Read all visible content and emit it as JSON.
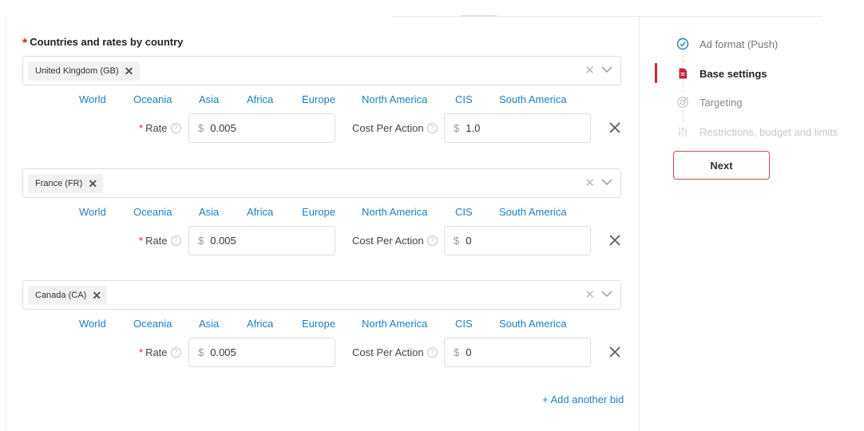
{
  "section": {
    "title": "Countries and rates by country",
    "required_mark": "*"
  },
  "regions": [
    "World",
    "Oceania",
    "Asia",
    "Africa",
    "Europe",
    "North America",
    "CIS",
    "South America"
  ],
  "labels": {
    "rate": "Rate",
    "rate_required": "*",
    "cpa": "Cost Per Action",
    "help_glyph": "?",
    "currency": "$",
    "tag_remove": "✕",
    "clear": "✕"
  },
  "bids": [
    {
      "country": "United Kingdom (GB)",
      "rate": "0.005",
      "cpa": "1.0"
    },
    {
      "country": "France (FR)",
      "rate": "0.005",
      "cpa": "0"
    },
    {
      "country": "Canada (CA)",
      "rate": "0.005",
      "cpa": "0"
    }
  ],
  "add_bid_label": "+ Add another bid",
  "steps": [
    {
      "label": "Ad format (Push)",
      "state": "done",
      "icon": "check-circle-icon"
    },
    {
      "label": "Base settings",
      "state": "active",
      "icon": "document-icon"
    },
    {
      "label": "Targeting",
      "state": "pending",
      "icon": "target-icon"
    },
    {
      "label": "Restrictions, budget and limits",
      "state": "disabled",
      "icon": "sliders-icon"
    }
  ],
  "next_label": "Next",
  "colors": {
    "link": "#1e7fc2",
    "accent": "#c9243f",
    "required": "#e02020",
    "done": "#1e7fc2"
  }
}
